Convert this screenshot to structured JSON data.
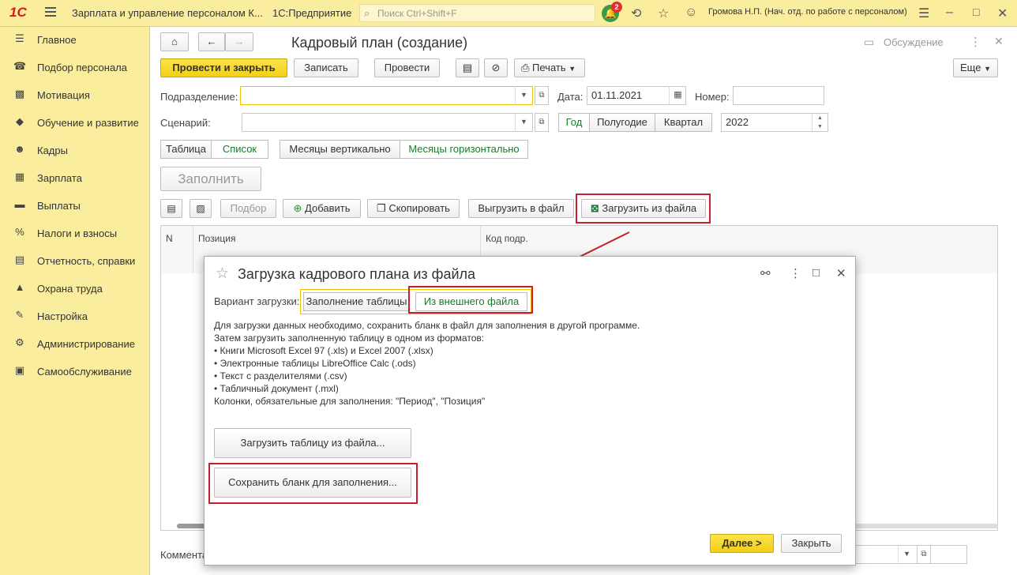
{
  "topbar": {
    "logo": "1С",
    "app_title": "Зарплата и управление персоналом К...",
    "platform": "1С:Предприятие",
    "search_placeholder": "Поиск Ctrl+Shift+F",
    "notif_count": "2",
    "user": "Громова Н.П. (Нач. отд. по работе с персоналом)"
  },
  "sidebar": {
    "items": [
      {
        "icon": "☰",
        "label": "Главное"
      },
      {
        "icon": "☎",
        "label": "Подбор персонала"
      },
      {
        "icon": "▩",
        "label": "Мотивация"
      },
      {
        "icon": "◆",
        "label": "Обучение и развитие"
      },
      {
        "icon": "☻",
        "label": "Кадры"
      },
      {
        "icon": "▦",
        "label": "Зарплата"
      },
      {
        "icon": "▬",
        "label": "Выплаты"
      },
      {
        "icon": "%",
        "label": "Налоги и взносы"
      },
      {
        "icon": "▤",
        "label": "Отчетность, справки"
      },
      {
        "icon": "▲",
        "label": "Охрана труда"
      },
      {
        "icon": "✎",
        "label": "Настройка"
      },
      {
        "icon": "⚙",
        "label": "Администрирование"
      },
      {
        "icon": "▣",
        "label": "Самообслуживание"
      }
    ]
  },
  "form": {
    "title": "Кадровый план (создание)",
    "discussion": "Обсуждение",
    "post_close": "Провести и закрыть",
    "save": "Записать",
    "post": "Провести",
    "print": "Печать",
    "more": "Еще",
    "dept_label": "Подразделение:",
    "dept_value": "",
    "date_label": "Дата:",
    "date_value": "01.11.2021",
    "number_label": "Номер:",
    "number_value": "",
    "scenario_label": "Сценарий:",
    "scenario_value": "",
    "period_year": "Год",
    "period_half": "Полугодие",
    "period_quarter": "Квартал",
    "year_value": "2022",
    "view_table": "Таблица",
    "view_list": "Список",
    "months_vertical": "Месяцы вертикально",
    "months_horizontal": "Месяцы горизонтально",
    "fill": "Заполнить",
    "pick": "Подбор",
    "add": "Добавить",
    "copy": "Скопировать",
    "export": "Выгрузить в файл",
    "import": "Загрузить из файла",
    "col_n": "N",
    "col_position": "Позиция",
    "col_dept_code": "Код подр.",
    "comment_label": "Коммента"
  },
  "dialog": {
    "title": "Загрузка кадрового плана из файла",
    "variant_label": "Вариант загрузки:",
    "variant_table": "Заполнение таблицы",
    "variant_file": "Из внешнего файла",
    "info_lines": [
      "Для загрузки данных необходимо, сохранить бланк в файл для заполнения в другой программе.",
      "Затем загрузить заполненную таблицу в одном из форматов:",
      "• Книги Microsoft Excel 97 (.xls) и Excel 2007 (.xlsx)",
      "• Электронные таблицы LibreOffice Calc (.ods)",
      "• Текст с разделителями (.csv)",
      "• Табличный документ (.mxl)",
      "Колонки, обязательные для заполнения: \"Период\", \"Позиция\""
    ],
    "load_table": "Загрузить таблицу из файла...",
    "save_blank": "Сохранить бланк для заполнения...",
    "next": "Далее >",
    "close": "Закрыть"
  },
  "colors": {
    "accent_yellow": "#fbed9e",
    "primary_button": "#f3cf16",
    "highlight_red": "#c8202a",
    "active_green": "#1a7a2a"
  }
}
